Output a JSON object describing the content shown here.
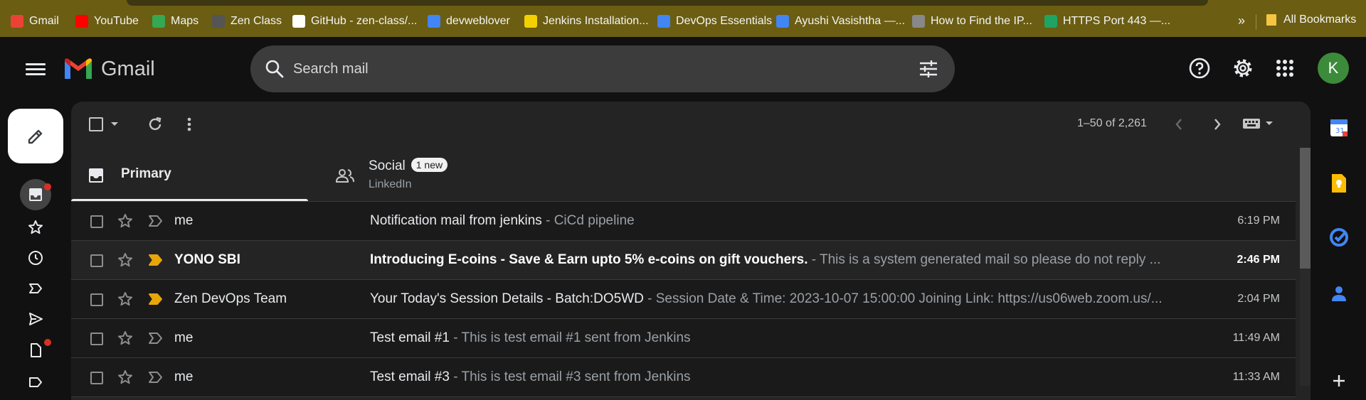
{
  "bookmarks": [
    {
      "label": "Gmail",
      "icon": "gmail-icon",
      "color": "#ea4335"
    },
    {
      "label": "YouTube",
      "icon": "youtube-icon",
      "color": "#ff0000"
    },
    {
      "label": "Maps",
      "icon": "maps-icon",
      "color": "#34a853"
    },
    {
      "label": "Zen Class",
      "icon": "zen-class-icon",
      "color": "#555555"
    },
    {
      "label": "GitHub - zen-class/...",
      "icon": "github-icon",
      "color": "#ffffff"
    },
    {
      "label": "devweblover",
      "icon": "devweblover-icon",
      "color": "#4285f4"
    },
    {
      "label": "Jenkins Installation...",
      "icon": "jenkins-icon",
      "color": "#f4d000"
    },
    {
      "label": "DevOps Essentials",
      "icon": "devops-icon",
      "color": "#4285f4"
    },
    {
      "label": "Ayushi Vasishtha —...",
      "icon": "ayushi-icon",
      "color": "#4285f4"
    },
    {
      "label": "How to Find the IP...",
      "icon": "linux-icon",
      "color": "#888888"
    },
    {
      "label": "HTTPS Port 443 —...",
      "icon": "https-icon",
      "color": "#1fa463"
    }
  ],
  "bookmarks_more": "»",
  "all_bookmarks": "All Bookmarks",
  "header": {
    "app_name": "Gmail",
    "search_placeholder": "Search mail",
    "avatar_letter": "K"
  },
  "toolbar": {
    "pager": "1–50 of 2,261"
  },
  "tabs": [
    {
      "label": "Primary",
      "sub": ""
    },
    {
      "label": "Social",
      "badge": "1 new",
      "sub": "LinkedIn"
    }
  ],
  "emails": [
    {
      "sender": "me",
      "subject": "Notification mail from jenkins",
      "snippet": " - CiCd pipeline",
      "time": "6:19 PM",
      "unread": false,
      "important": false
    },
    {
      "sender": "YONO SBI",
      "subject": "Introducing E-coins - Save & Earn upto 5% e-coins on gift vouchers.",
      "snippet": " - This is a system generated mail so please do not reply ...",
      "time": "2:46 PM",
      "unread": true,
      "important": true
    },
    {
      "sender": "Zen DevOps Team",
      "subject": "Your Today's Session Details - Batch:DO5WD",
      "snippet": " - Session Date & Time: 2023-10-07 15:00:00 Joining Link: https://us06web.zoom.us/...",
      "time": "2:04 PM",
      "unread": false,
      "important": true
    },
    {
      "sender": "me",
      "subject": "Test email #1",
      "snippet": " - This is test email #1 sent from Jenkins",
      "time": "11:49 AM",
      "unread": false,
      "important": false
    },
    {
      "sender": "me",
      "subject": "Test email #3",
      "snippet": " - This is test email #3 sent from Jenkins",
      "time": "11:33 AM",
      "unread": false,
      "important": false
    }
  ],
  "colors": {
    "bookmark_bar": "#6b5d12",
    "important_marker": "#e8a60a",
    "avatar": "#3b8b3b",
    "notification_dot": "#d93025"
  }
}
